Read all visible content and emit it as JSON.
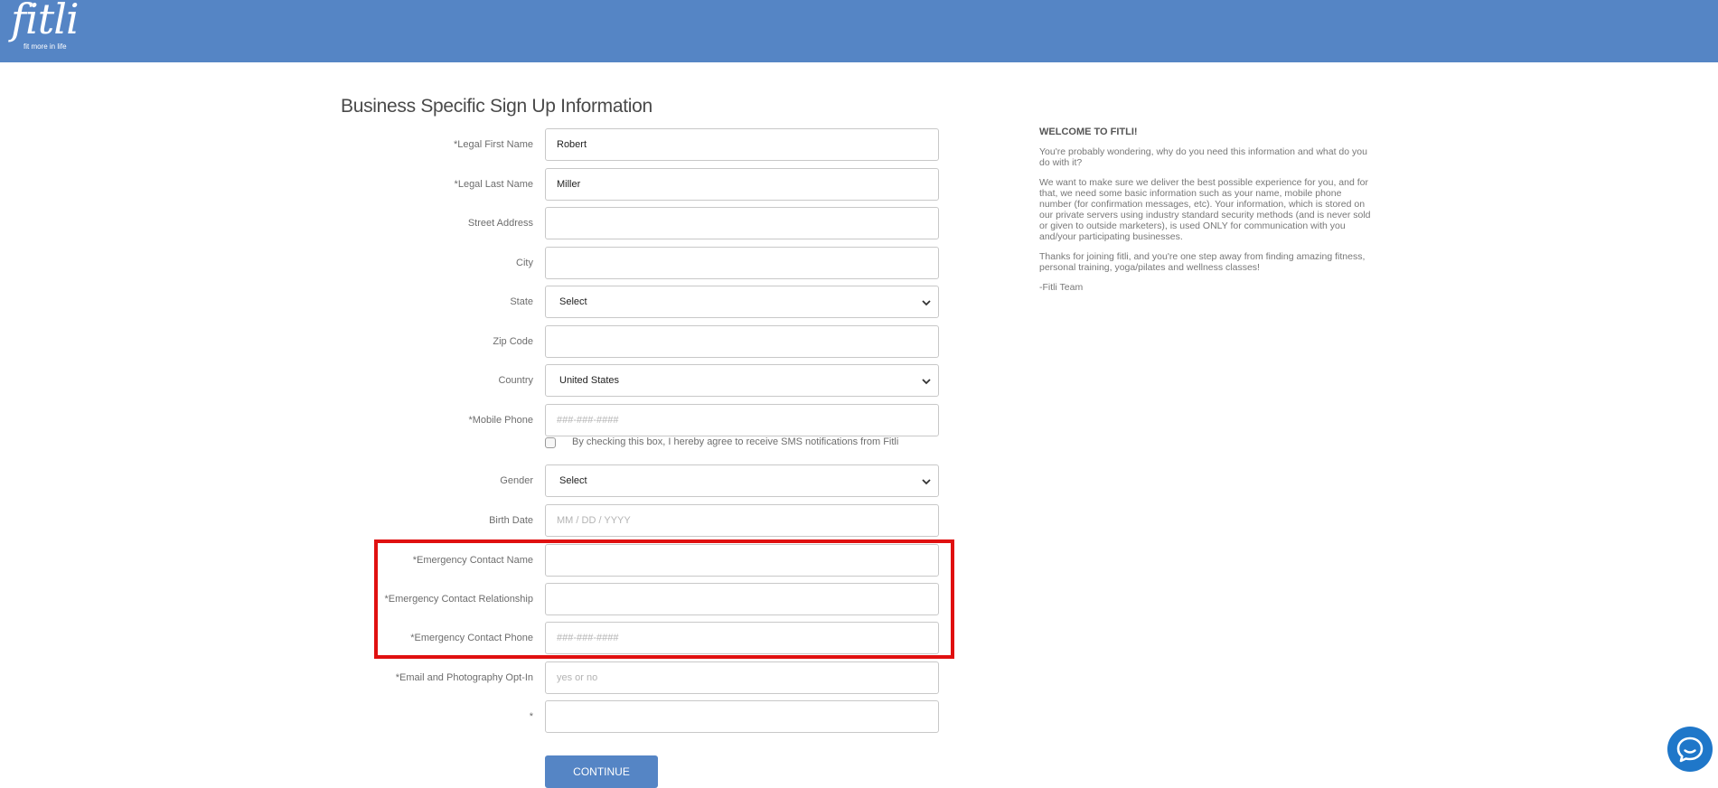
{
  "logo": {
    "word": "fitli",
    "tagline": "fit more in life"
  },
  "page": {
    "title": "Business Specific Sign Up Information"
  },
  "form": {
    "first_name": {
      "label": "*Legal First Name",
      "value": "Robert"
    },
    "last_name": {
      "label": "*Legal Last Name",
      "value": "Miller"
    },
    "street": {
      "label": "Street Address",
      "value": ""
    },
    "city": {
      "label": "City",
      "value": ""
    },
    "state": {
      "label": "State",
      "selected": "Select"
    },
    "zip": {
      "label": "Zip Code",
      "value": ""
    },
    "country": {
      "label": "Country",
      "selected": "United States"
    },
    "mobile": {
      "label": "*Mobile Phone",
      "placeholder": "###-###-####"
    },
    "sms_consent": "By checking this box, I hereby agree to receive SMS notifications from Fitli",
    "gender": {
      "label": "Gender",
      "selected": "Select"
    },
    "birth_date": {
      "label": "Birth Date",
      "placeholder": "MM / DD / YYYY"
    },
    "emergency_name": {
      "label": "*Emergency Contact Name",
      "value": ""
    },
    "emergency_relationship": {
      "label": "*Emergency Contact Relationship",
      "value": ""
    },
    "emergency_phone": {
      "label": "*Emergency Contact Phone",
      "placeholder": "###-###-####"
    },
    "opt_in": {
      "label": "*Email and Photography Opt-In",
      "placeholder": "yes or no"
    },
    "extra": {
      "label": "*",
      "value": ""
    },
    "continue_label": "CONTINUE"
  },
  "side": {
    "title": "WELCOME TO FITLI!",
    "p1": "You're probably wondering, why do you need this information and what do you do with it?",
    "p2": "We want to make sure we deliver the best possible experience for you, and for that, we need some basic information such as your name, mobile phone number (for confirmation messages, etc). Your information, which is stored on our private servers using industry standard security methods (and is never sold or given to outside marketers), is used ONLY for communication with you and/your participating businesses.",
    "p3": "Thanks for joining fitli, and you're one step away from finding amazing fitness, personal training, yoga/pilates and wellness classes!",
    "signoff": "-Fitli Team"
  },
  "colors": {
    "header": "#5585c5",
    "highlight": "#e01010",
    "button": "#5585c5",
    "chat": "#1f77c9"
  },
  "icons": {
    "chat": "chat-bubble-icon",
    "dropdown": "chevron-down-icon"
  }
}
